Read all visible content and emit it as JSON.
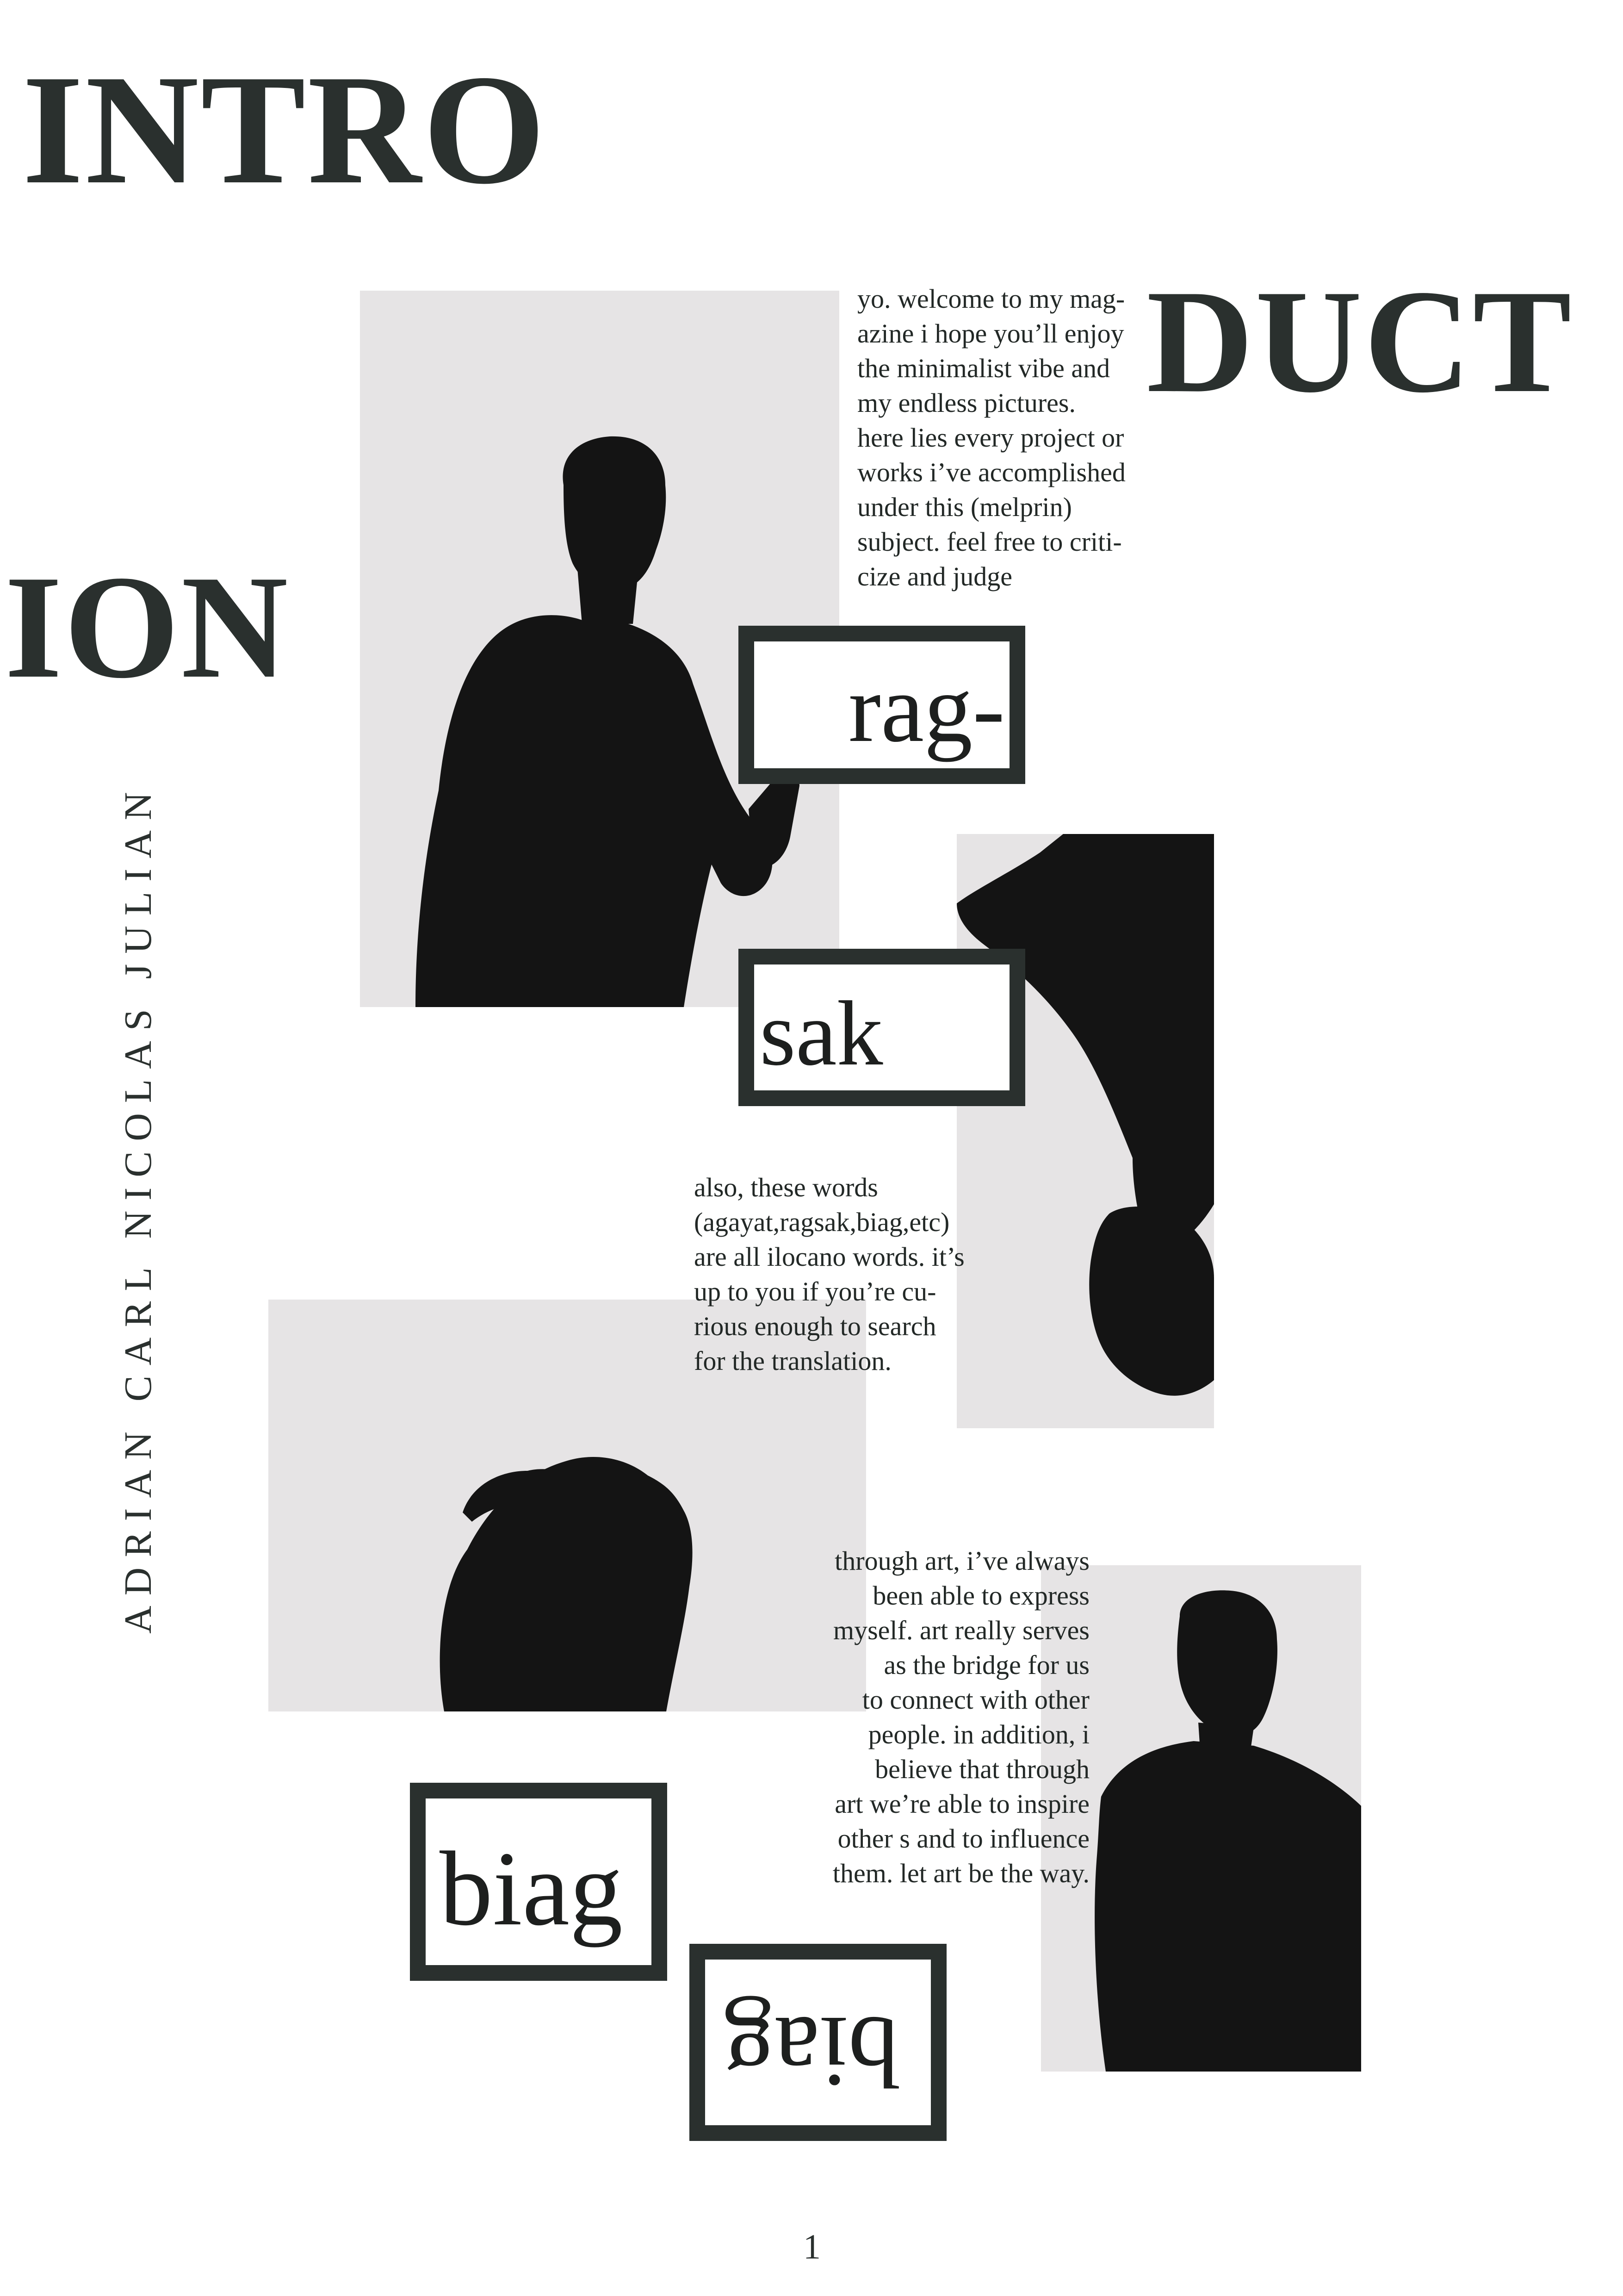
{
  "headline": {
    "part1": "INTRO",
    "part2": "DUCT",
    "part3": "ION"
  },
  "author": "ADRIAN CARL NICOLAS JULIAN",
  "paragraphs": {
    "welcome": [
      "yo. welcome to my mag-",
      "azine i hope you’ll enjoy",
      "the minimalist vibe and",
      "my endless pictures.",
      "here lies every project or",
      "works i’ve accomplished",
      "under this (melprin)",
      "subject. feel free to criti-",
      "cize and judge"
    ],
    "words_note": [
      "also, these words",
      "(agayat,ragsak,biag,etc)",
      "are all ilocano words. it’s",
      "up to you if you’re cu-",
      "rious enough to search",
      "for the translation."
    ],
    "art": [
      "through art, i’ve always",
      "been able to express",
      "myself. art really serves",
      "as the bridge for us",
      "to connect with other",
      "people. in addition, i",
      "believe that through",
      "art we’re able to inspire",
      "other s and to influence",
      "them. let art be the way."
    ]
  },
  "word_boxes": {
    "rag": "rag-",
    "sak": "sak",
    "biag": "biag",
    "biag_flipped": "biag"
  },
  "page_number": "1",
  "colors": {
    "ink": "#2a302e",
    "photo_bg": "#e6e4e5",
    "silhouette": "#141414"
  }
}
